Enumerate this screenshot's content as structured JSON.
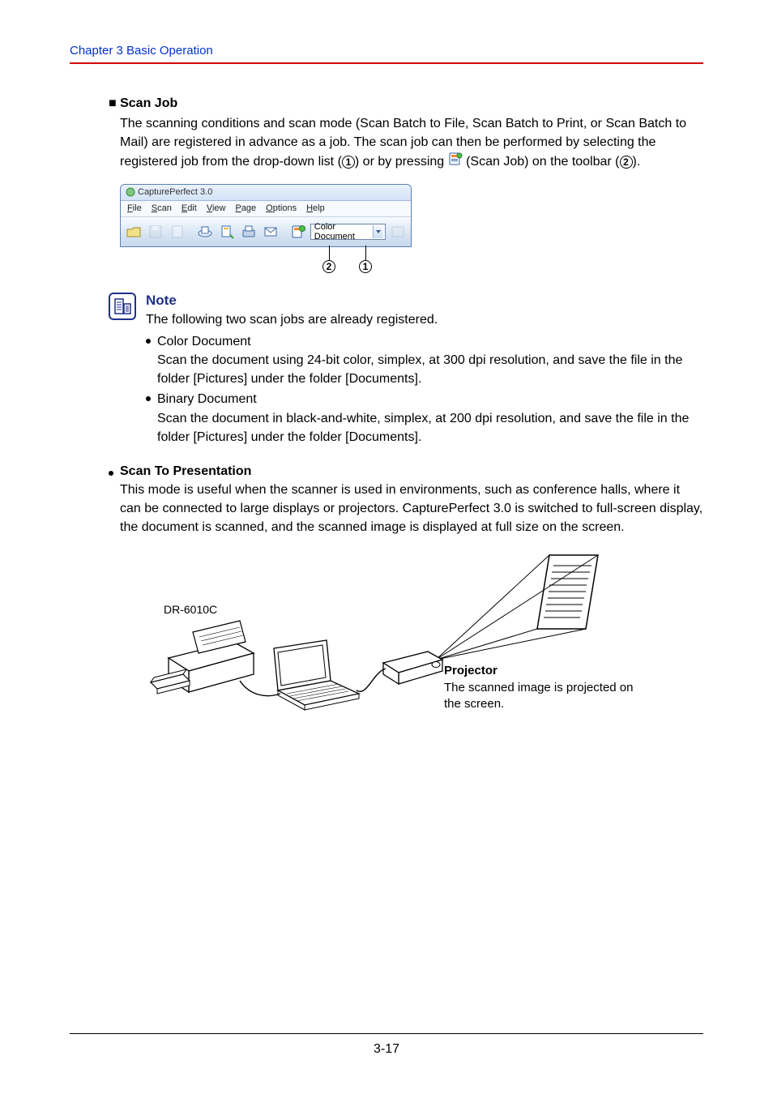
{
  "header": {
    "chapter": "Chapter 3   Basic Operation"
  },
  "scanjob": {
    "title": "Scan Job",
    "desc_pre": "The scanning conditions and scan mode (Scan Batch to File, Scan Batch to Print, or Scan Batch to Mail) are registered in advance as a job. The scan job can then be performed by selecting the registered job from the drop-down list (",
    "desc_mid1": ") or by pressing ",
    "desc_mid2": " (Scan Job) on the toolbar (",
    "desc_end": ")."
  },
  "callout": {
    "one": "1",
    "two": "2"
  },
  "shot": {
    "title": "CapturePerfect 3.0",
    "menu": {
      "file": "File",
      "scan": "Scan",
      "edit": "Edit",
      "view": "View",
      "page": "Page",
      "options": "Options",
      "help": "Help"
    },
    "combo": "Color Document"
  },
  "note": {
    "title": "Note",
    "intro": "The following two scan jobs are already registered.",
    "items": [
      {
        "title": "Color Document",
        "desc": "Scan the document using 24-bit color, simplex, at 300 dpi resolution, and save the file in the folder [Pictures] under the folder [Documents]."
      },
      {
        "title": "Binary Document",
        "desc": "Scan the document in black-and-white, simplex, at 200 dpi resolution, and save the file in the folder [Pictures] under the folder [Documents]."
      }
    ]
  },
  "stp": {
    "title": "Scan To Presentation",
    "desc": "This mode is useful when the scanner is used in environments, such as conference halls, where it can be connected to large displays or projectors. CapturePerfect 3.0 is switched to full-screen display, the document is scanned, and the scanned image is displayed at full size on the screen."
  },
  "diagram": {
    "scanner_label": "DR-6010C",
    "projector_title": "Projector",
    "projector_desc": "The scanned image is projected on the screen."
  },
  "footer": {
    "page": "3-17"
  },
  "chart_data": null
}
